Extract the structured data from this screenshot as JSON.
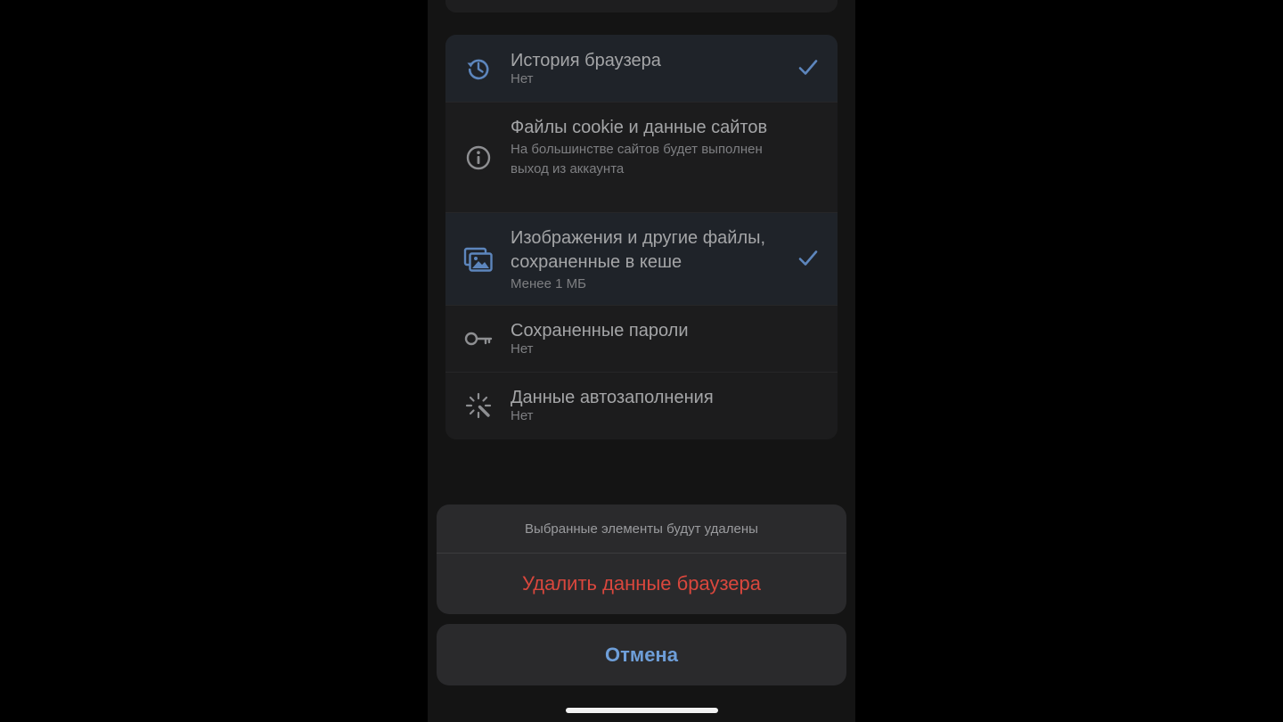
{
  "items": [
    {
      "icon": "history-icon",
      "title": "История браузера",
      "subtitle": "Нет",
      "selected": true
    },
    {
      "icon": "info-icon",
      "title": "Файлы cookie и данные сайтов",
      "subtitle": "На большинстве сайтов будет выполнен выход из аккаунта",
      "selected": false
    },
    {
      "icon": "images-icon",
      "title": "Изображения и другие файлы, сохраненные в кеше",
      "subtitle": "Менее 1 МБ",
      "selected": true
    },
    {
      "icon": "key-icon",
      "title": "Сохраненные пароли",
      "subtitle": "Нет",
      "selected": false
    },
    {
      "icon": "magic-wand-icon",
      "title": "Данные автозаполнения",
      "subtitle": "Нет",
      "selected": false
    }
  ],
  "action_sheet": {
    "message": "Выбранные элементы будут удалены",
    "destructive_label": "Удалить данные браузера",
    "cancel_label": "Отмена"
  },
  "colors": {
    "accent_blue": "#6e9ed8",
    "destructive_red": "#d9473d",
    "icon_selected": "#5d86bd",
    "icon_default": "#8e8f92"
  }
}
